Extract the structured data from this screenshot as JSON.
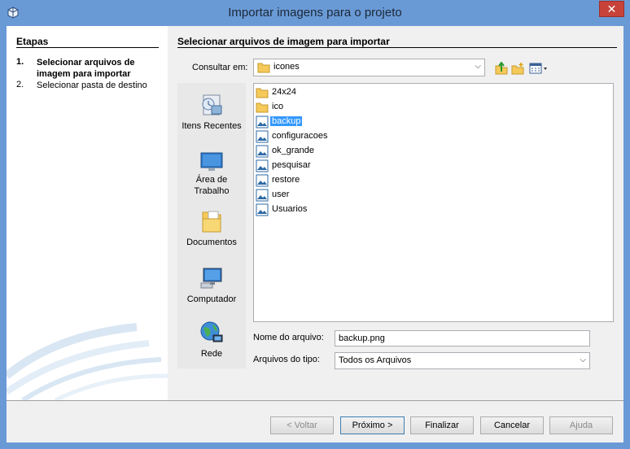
{
  "window": {
    "title": "Importar imagens para o projeto",
    "close_glyph": "✕"
  },
  "steps": {
    "heading": "Etapas",
    "items": [
      {
        "num": "1.",
        "label": "Selecionar arquivos de imagem para importar",
        "active": true
      },
      {
        "num": "2.",
        "label": "Selecionar pasta de destino",
        "active": false
      }
    ]
  },
  "main": {
    "heading": "Selecionar arquivos de imagem para importar",
    "look_in_label": "Consultar em:",
    "look_in_value": "icones",
    "toolbar_icons": [
      "up-folder-icon",
      "new-folder-icon",
      "view-menu-icon"
    ]
  },
  "places": [
    {
      "label": "Itens Recentes",
      "icon": "recent-items-icon"
    },
    {
      "label": "Área de Trabalho",
      "icon": "desktop-icon"
    },
    {
      "label": "Documentos",
      "icon": "documents-icon"
    },
    {
      "label": "Computador",
      "icon": "computer-icon"
    },
    {
      "label": "Rede",
      "icon": "network-icon"
    }
  ],
  "files": [
    {
      "name": "24x24",
      "type": "folder"
    },
    {
      "name": "ico",
      "type": "folder"
    },
    {
      "name": "backup",
      "type": "image",
      "selected": true
    },
    {
      "name": "configuracoes",
      "type": "image"
    },
    {
      "name": "ok_grande",
      "type": "image"
    },
    {
      "name": "pesquisar",
      "type": "image"
    },
    {
      "name": "restore",
      "type": "image"
    },
    {
      "name": "user",
      "type": "image"
    },
    {
      "name": "Usuarios",
      "type": "image"
    }
  ],
  "fields": {
    "filename_label": "Nome do arquivo:",
    "filename_value": "backup.png",
    "filetype_label": "Arquivos do tipo:",
    "filetype_value": "Todos os Arquivos"
  },
  "buttons": {
    "back": "< Voltar",
    "next": "Próximo >",
    "finish": "Finalizar",
    "cancel": "Cancelar",
    "help": "Ajuda"
  },
  "colors": {
    "title_bar": "#6a9ad6",
    "close_button": "#c7433a",
    "selection": "#3399ff"
  }
}
